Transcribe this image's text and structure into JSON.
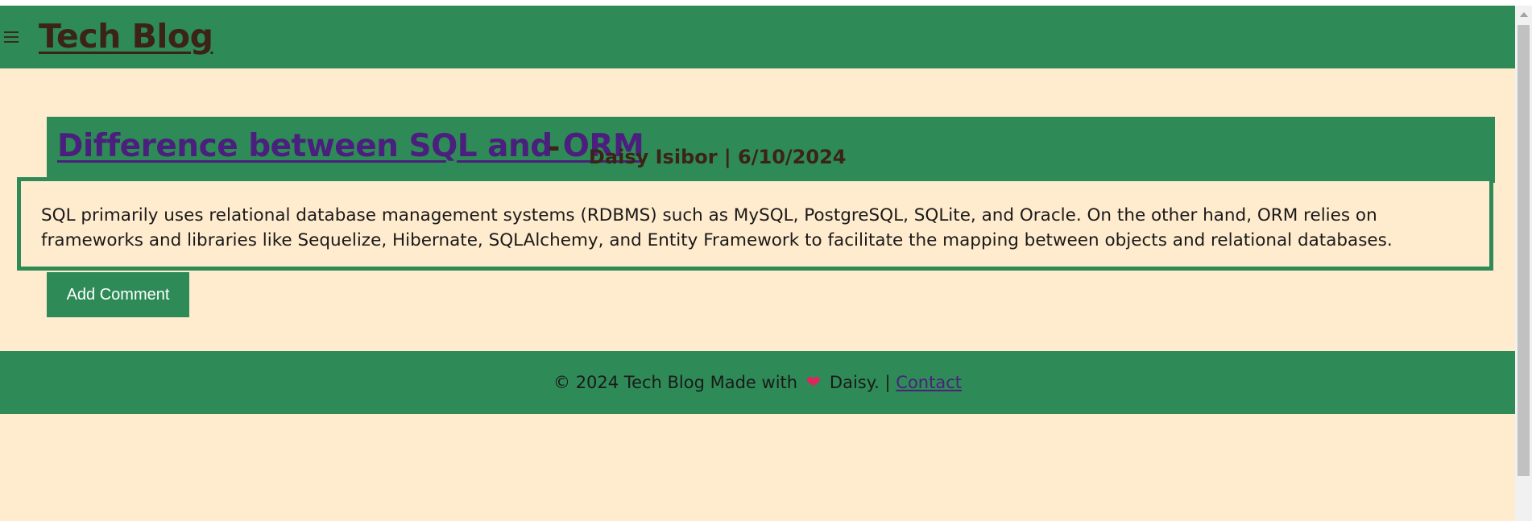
{
  "header": {
    "site_title": "Tech Blog",
    "menu_icon": "hamburger-menu-icon"
  },
  "post": {
    "title": "Difference between SQL and ORM",
    "separator": "-",
    "meta": "Daisy Isibor | 6/10/2024",
    "body": "SQL primarily uses relational database management systems (RDBMS) such as MySQL, PostgreSQL, SQLite, and Oracle. On the other hand, ORM relies on frameworks and libraries like Sequelize, Hibernate, SQLAlchemy, and Entity Framework to facilitate the mapping between objects and relational databases.",
    "add_comment_label": "Add Comment"
  },
  "footer": {
    "text_before": "© 2024 Tech Blog Made with",
    "heart": "❤",
    "text_after": "Daisy. |",
    "contact_label": "Contact"
  },
  "colors": {
    "primary_green": "#2e8b57",
    "background": "#ffebcd",
    "title_brown": "#3b2417",
    "link_purple": "#4b1f7d",
    "heart_red": "#e0245e"
  }
}
